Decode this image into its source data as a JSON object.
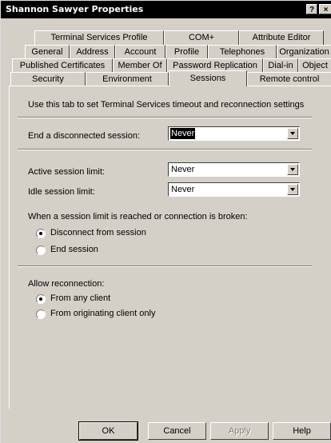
{
  "window": {
    "title": "Shannon Sawyer Properties",
    "help_button": "?",
    "close_button": "×"
  },
  "tabs": {
    "row1": [
      {
        "label": "Terminal Services Profile"
      },
      {
        "label": "COM+"
      },
      {
        "label": "Attribute Editor"
      }
    ],
    "row2": [
      {
        "label": "General"
      },
      {
        "label": "Address"
      },
      {
        "label": "Account"
      },
      {
        "label": "Profile"
      },
      {
        "label": "Telephones"
      },
      {
        "label": "Organization"
      }
    ],
    "row3": [
      {
        "label": "Published Certificates"
      },
      {
        "label": "Member Of"
      },
      {
        "label": "Password Replication"
      },
      {
        "label": "Dial-in"
      },
      {
        "label": "Object"
      }
    ],
    "row4": [
      {
        "label": "Security"
      },
      {
        "label": "Environment"
      },
      {
        "label": "Sessions",
        "active": true
      },
      {
        "label": "Remote control"
      }
    ]
  },
  "sessions": {
    "intro": "Use this tab to set Terminal Services timeout and reconnection settings",
    "end_disconnected_label": "End a disconnected session:",
    "end_disconnected_value": "Never",
    "active_limit_label": "Active session limit:",
    "active_limit_value": "Never",
    "idle_limit_label": "Idle session limit:",
    "idle_limit_value": "Never",
    "limit_reached_label": "When a session limit is reached or connection is broken:",
    "disconnect_option": "Disconnect from session",
    "end_session_option": "End session",
    "limit_reached_selected": "Disconnect from session",
    "allow_reconnection_label": "Allow reconnection:",
    "any_client_option": "From any client",
    "originating_client_option": "From originating client only",
    "reconnection_selected": "From any client"
  },
  "buttons": {
    "ok": "OK",
    "cancel": "Cancel",
    "apply": "Apply",
    "help": "Help"
  }
}
